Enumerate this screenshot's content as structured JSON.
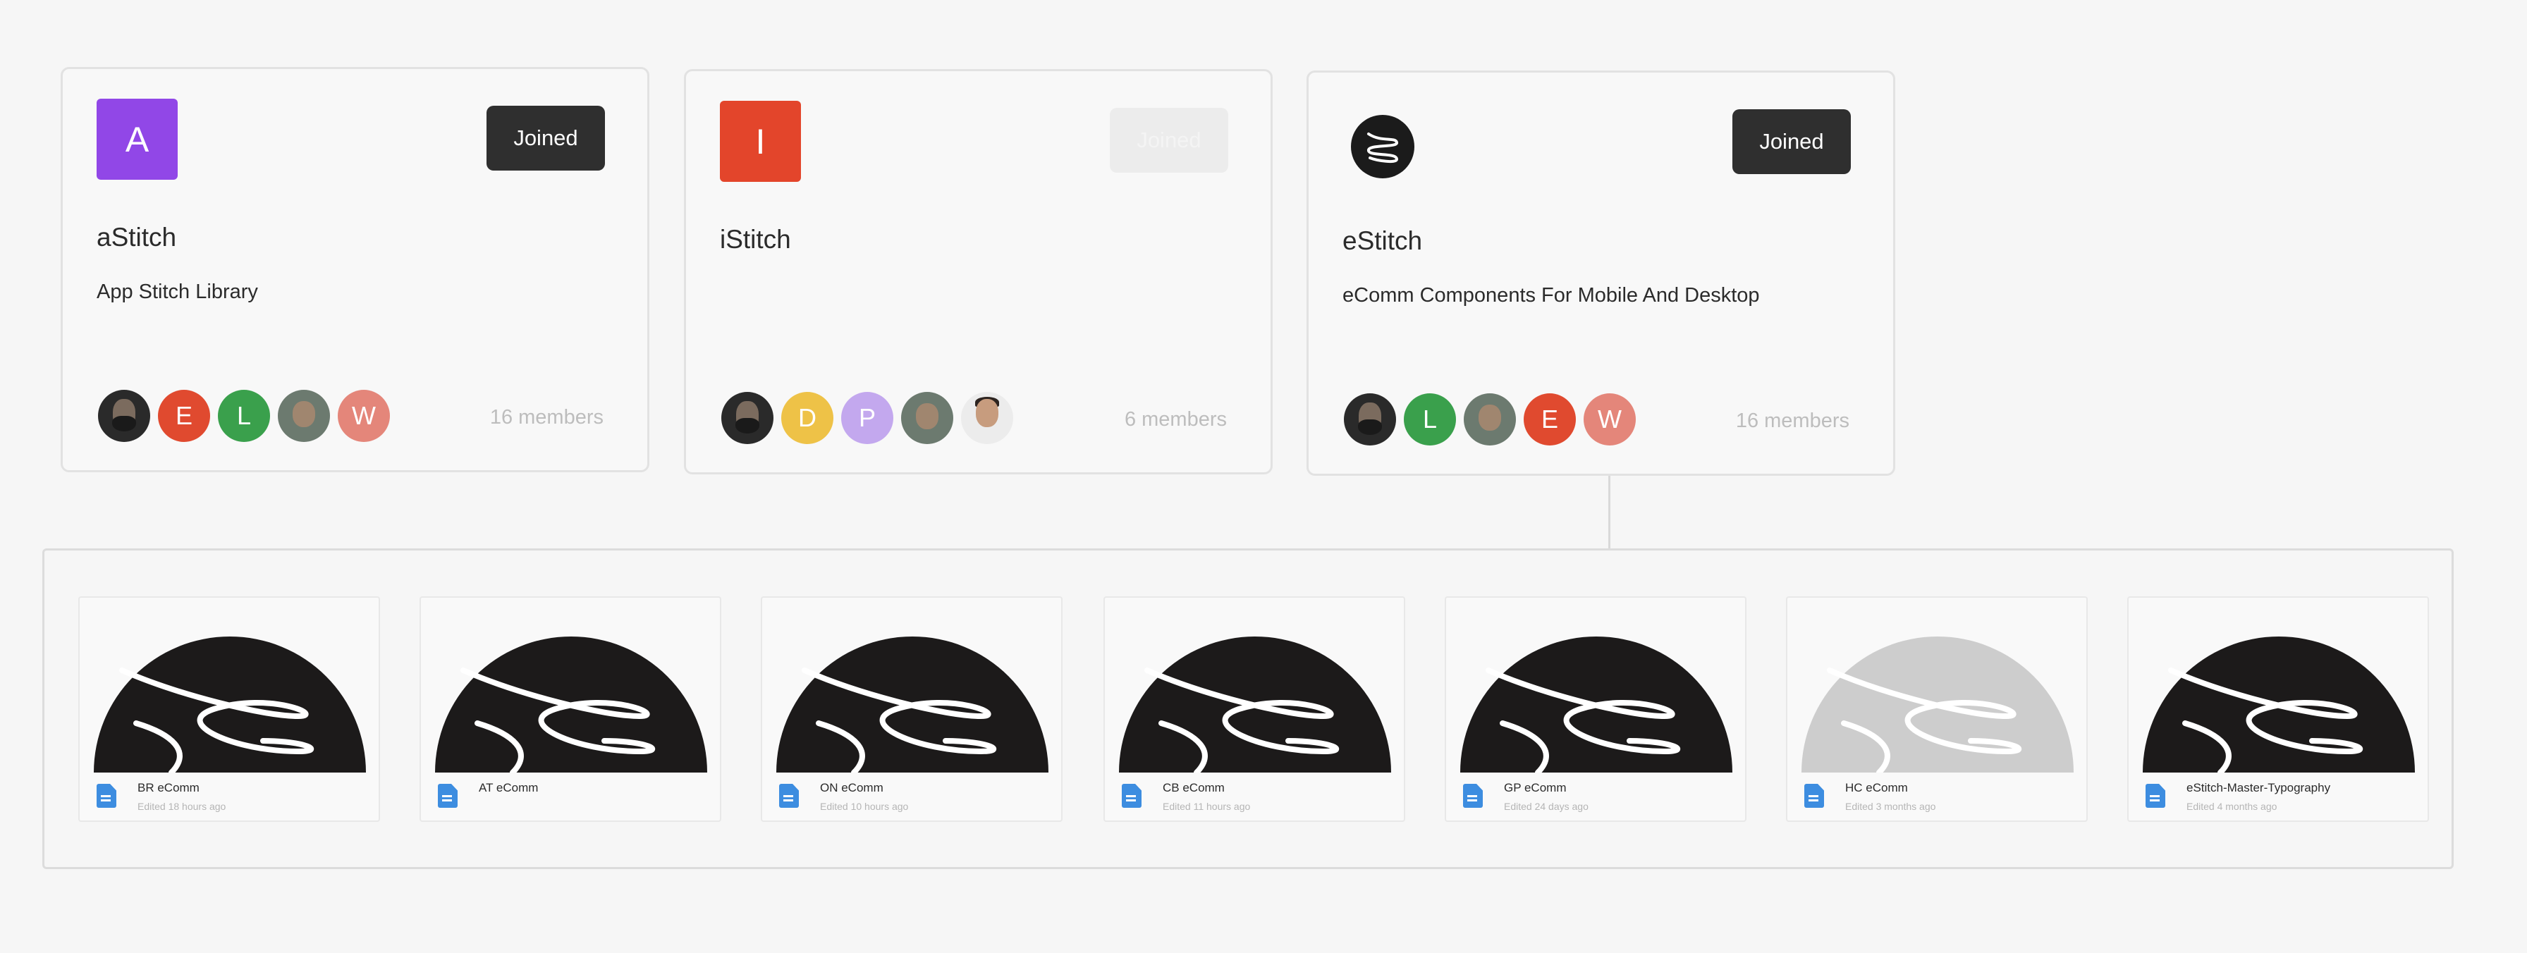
{
  "teams": [
    {
      "logo_letter": "A",
      "logo_color": "#9147e7",
      "join_label": "Joined",
      "name": "aStitch",
      "description": "App Stitch Library",
      "members": [
        {
          "type": "photo"
        },
        {
          "type": "letter",
          "letter": "E",
          "color": "#e04a2f"
        },
        {
          "type": "letter",
          "letter": "L",
          "color": "#3aa04c"
        },
        {
          "type": "photo2"
        },
        {
          "type": "letter",
          "letter": "W",
          "color": "#e4867a"
        }
      ],
      "member_count": "16 members"
    },
    {
      "logo_letter": "I",
      "logo_color": "#e3452b",
      "join_label": "Joined",
      "name": "iStitch",
      "description": "",
      "members": [
        {
          "type": "photo"
        },
        {
          "type": "letter",
          "letter": "D",
          "color": "#eec247"
        },
        {
          "type": "letter",
          "letter": "P",
          "color": "#c3a8ee"
        },
        {
          "type": "photo2"
        },
        {
          "type": "photo3"
        }
      ],
      "member_count": "6 members"
    },
    {
      "logo_icon": "estitch-swirl-icon",
      "join_label": "Joined",
      "name": "eStitch",
      "description": "eComm Components For Mobile And Desktop",
      "members": [
        {
          "type": "photo"
        },
        {
          "type": "letter",
          "letter": "L",
          "color": "#3aa04c"
        },
        {
          "type": "photo2"
        },
        {
          "type": "letter",
          "letter": "E",
          "color": "#e04a2f"
        },
        {
          "type": "letter",
          "letter": "W",
          "color": "#e4867a"
        }
      ],
      "member_count": "16 members"
    }
  ],
  "files": [
    {
      "name": "BR eComm",
      "edited": "Edited 18 hours ago",
      "thumb": "dark"
    },
    {
      "name": "AT eComm",
      "edited": "",
      "thumb": "dark"
    },
    {
      "name": "ON eComm",
      "edited": "Edited 10 hours ago",
      "thumb": "dark"
    },
    {
      "name": "CB eComm",
      "edited": "Edited 11 hours ago",
      "thumb": "dark"
    },
    {
      "name": "GP eComm",
      "edited": "Edited 24 days ago",
      "thumb": "dark"
    },
    {
      "name": "HC eComm",
      "edited": "Edited 3 months ago",
      "thumb": "light"
    },
    {
      "name": "eStitch-Master-Typography",
      "edited": "Edited 4 months ago",
      "thumb": "dark"
    }
  ],
  "colors": {
    "thumb_dark": "#1c1a1a",
    "thumb_light": "#cdcdcd",
    "file_icon": "#3d8de0"
  }
}
